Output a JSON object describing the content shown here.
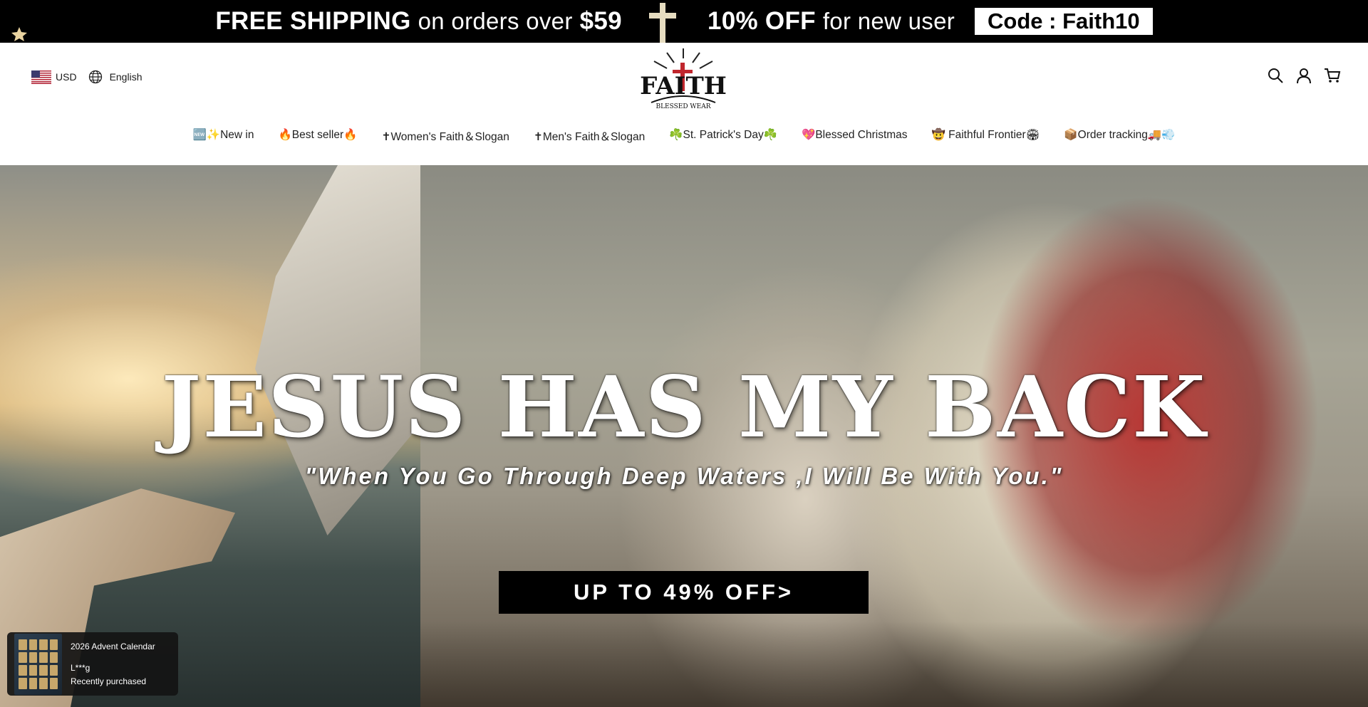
{
  "announcement": {
    "shipping_main": "FREE SHIPPING",
    "shipping_rest": "on orders over",
    "shipping_amount": "$59",
    "offer_main": "10% OFF",
    "offer_rest": "for new user",
    "code": "Code : Faith10"
  },
  "header": {
    "currency": "USD",
    "language": "English",
    "logo_text": "FAITH",
    "logo_subtext": "BLESSED WEAR"
  },
  "nav": {
    "items": [
      {
        "label": "🆕✨New in"
      },
      {
        "label": "🔥Best seller🔥"
      },
      {
        "label": "✝Women's Faith＆Slogan"
      },
      {
        "label": "✝Men's Faith＆Slogan"
      },
      {
        "label": "☘️St. Patrick's Day☘️"
      },
      {
        "label": "💖Blessed Christmas"
      },
      {
        "label": "🤠 Faithful Frontier🏟"
      },
      {
        "label": "📦Order tracking🚚💨"
      }
    ]
  },
  "hero": {
    "headline": "JESUS HAS MY BACK",
    "quote": "\"When You Go Through Deep Waters ,I Will Be With You.\"",
    "cta": "UP TO 49% OFF>"
  },
  "popup": {
    "product": "2026 Advent Calendar",
    "buyer": "L***g",
    "status": "Recently purchased"
  },
  "icons": [
    "us-flag-icon",
    "globe-icon",
    "search-icon",
    "account-icon",
    "cart-icon",
    "cross-icon"
  ]
}
